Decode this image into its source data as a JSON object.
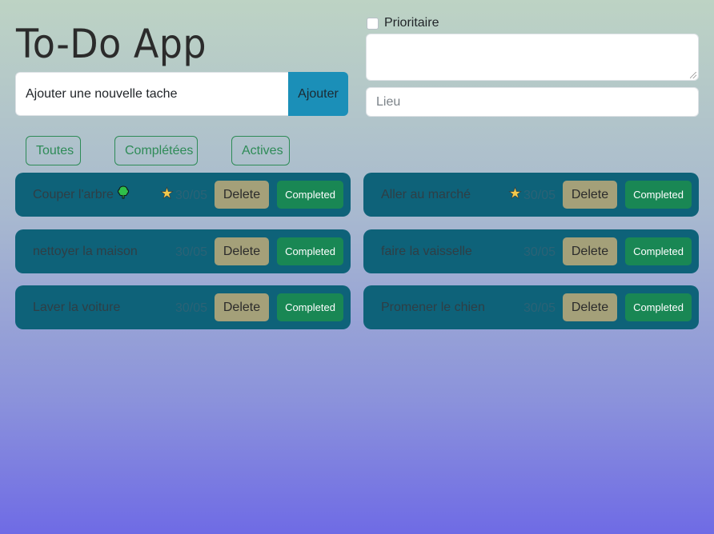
{
  "header": {
    "title": "To-Do App"
  },
  "add_form": {
    "input_value": "Ajouter une nouvelle tache",
    "add_label": "Ajouter",
    "priority_label": "Prioritaire",
    "priority_checked": false,
    "description_value": "",
    "location_placeholder": "Lieu"
  },
  "filters": [
    {
      "label": "Toutes"
    },
    {
      "label": "Complétées"
    },
    {
      "label": "Actives"
    }
  ],
  "tasks": [
    {
      "title": "Couper l'arbre",
      "icon": "tree-icon",
      "priority": true,
      "date": "30/05",
      "delete_label": "Delete",
      "complete_label": "Completed"
    },
    {
      "title": "Aller au marché",
      "icon": "",
      "priority": true,
      "date": "30/05",
      "delete_label": "Delete",
      "complete_label": "Completed"
    },
    {
      "title": "nettoyer la maison",
      "icon": "",
      "priority": false,
      "date": "30/05",
      "delete_label": "Delete",
      "complete_label": "Completed"
    },
    {
      "title": "faire la vaisselle",
      "icon": "",
      "priority": false,
      "date": "30/05",
      "delete_label": "Delete",
      "complete_label": "Completed"
    },
    {
      "title": "Laver la voiture",
      "icon": "",
      "priority": false,
      "date": "30/05",
      "delete_label": "Delete",
      "complete_label": "Completed"
    },
    {
      "title": "Promener le chien",
      "icon": "",
      "priority": false,
      "date": "30/05",
      "delete_label": "Delete",
      "complete_label": "Completed"
    }
  ],
  "colors": {
    "task_card": "#0e6279",
    "delete_button": "#a4a079",
    "completed_button": "#198754",
    "add_button": "#1b8fb8",
    "filter_outline": "#2e8b57",
    "star": "#f2c94c"
  }
}
